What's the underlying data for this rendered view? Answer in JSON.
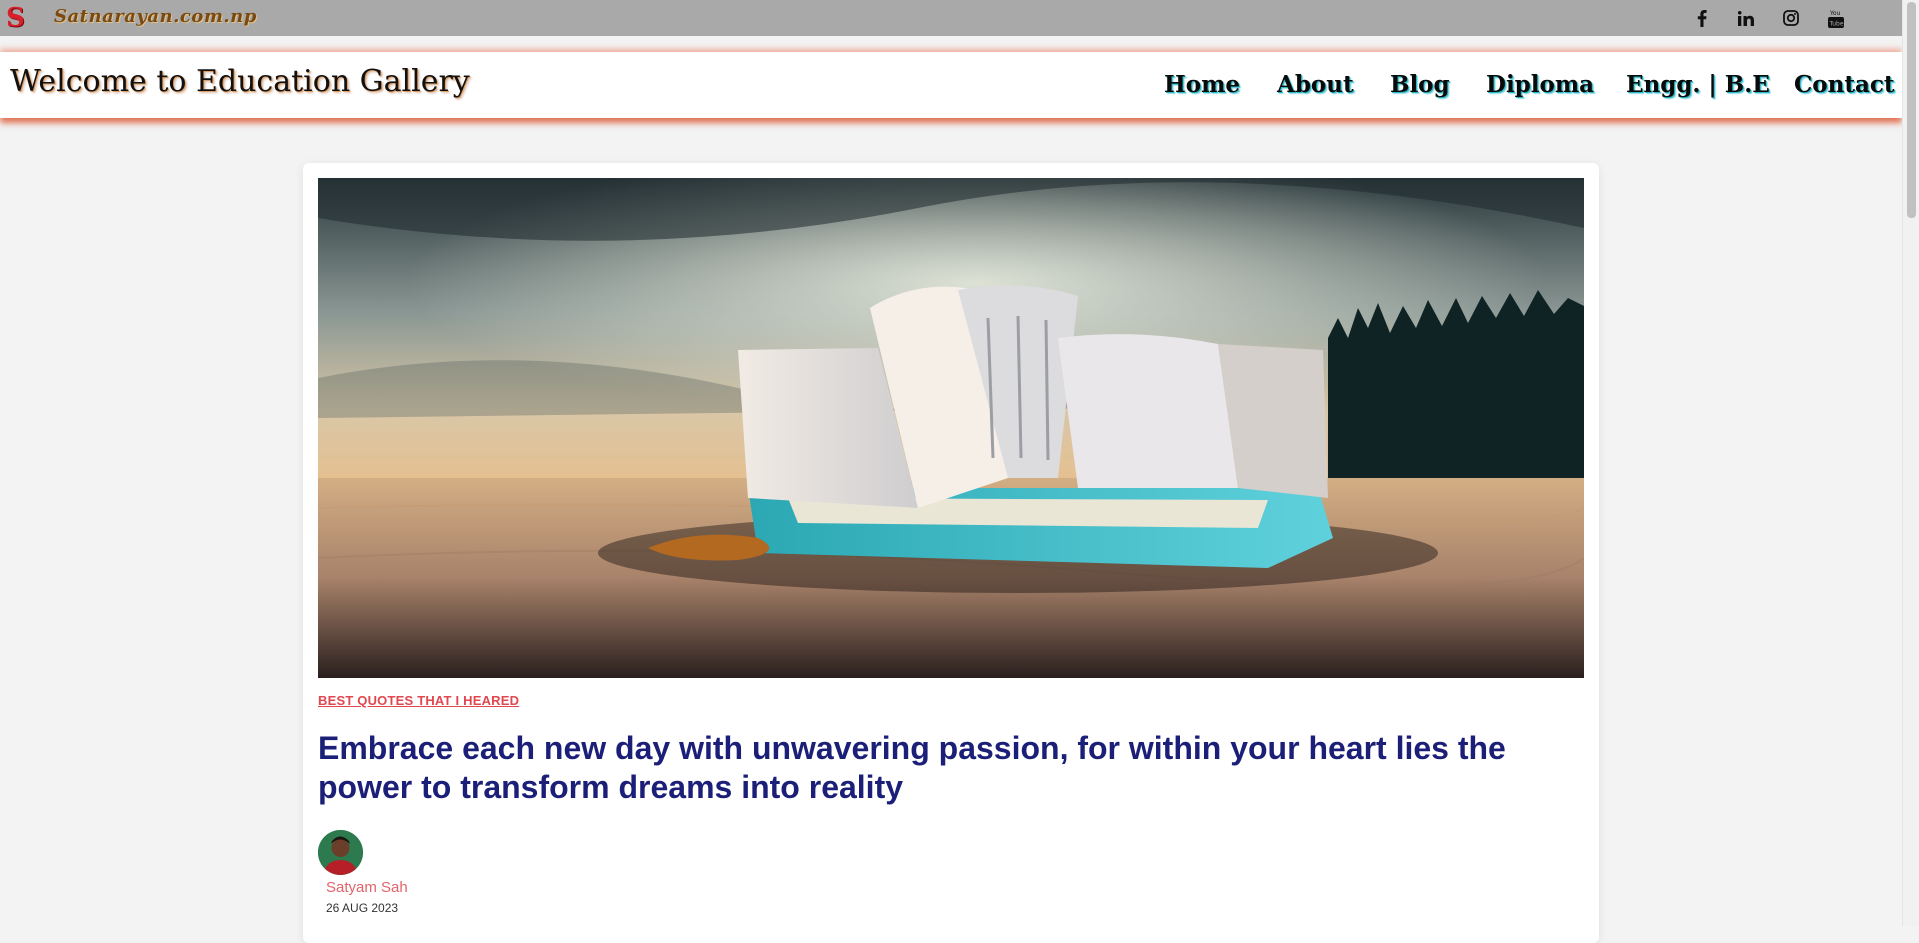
{
  "topbar": {
    "logo_letter": "S",
    "site_name": "Satnarayan.com.np",
    "social_icons": [
      "facebook-icon",
      "linkedin-icon",
      "instagram-icon",
      "youtube-icon"
    ]
  },
  "header": {
    "brand": "Welcome to Education Gallery",
    "nav": [
      "Home",
      "About",
      "Blog",
      "Diploma",
      "Engg. | B.E",
      "Contact"
    ]
  },
  "post": {
    "category": "BEST QUOTES THAT I HEARED",
    "title": "Embrace each new day with unwavering passion, for within your heart lies the power to transform dreams into reality",
    "author": "Satyam Sah",
    "date": "26 AUG 2023",
    "hero_image": "open-book-on-sand-under-cloudy-sky"
  },
  "colors": {
    "topbar_bg": "#a9a9a9",
    "header_glow": "#dc5f3c",
    "nav_shadow": "#2bb9c9",
    "category": "#e0474f",
    "title": "#1b1f78",
    "author": "#e0646a"
  }
}
